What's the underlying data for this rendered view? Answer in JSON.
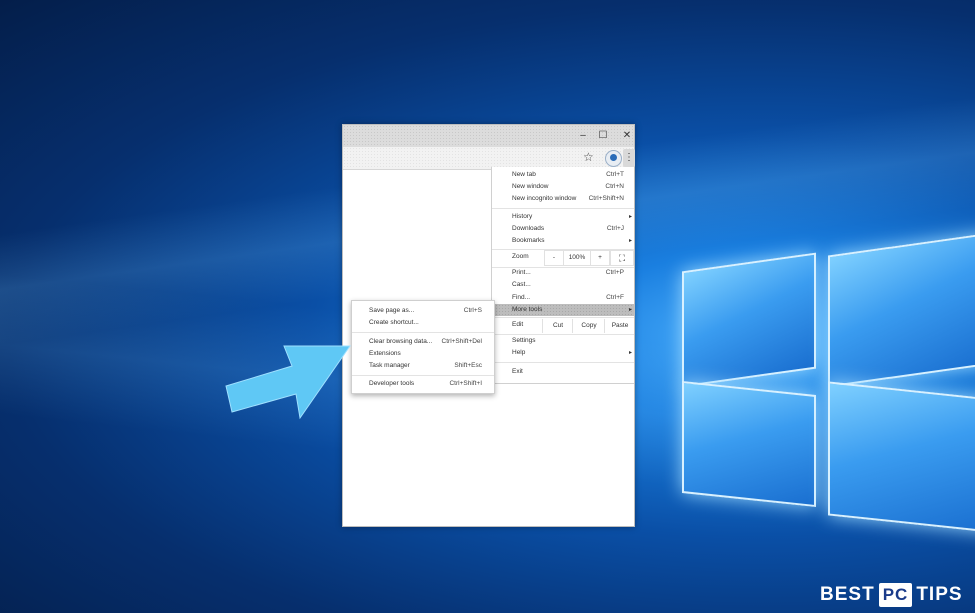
{
  "browser": {
    "window_controls": {
      "minimize": "–",
      "maximize": "☐",
      "close": "✕"
    },
    "toolbar": {
      "star": "☆",
      "menu": "⋮"
    }
  },
  "menu": {
    "items": [
      {
        "label": "New tab",
        "shortcut": "Ctrl+T"
      },
      {
        "label": "New window",
        "shortcut": "Ctrl+N"
      },
      {
        "label": "New incognito window",
        "shortcut": "Ctrl+Shift+N"
      },
      {
        "label": "History",
        "shortcut": ""
      },
      {
        "label": "Downloads",
        "shortcut": "Ctrl+J"
      },
      {
        "label": "Bookmarks",
        "shortcut": ""
      },
      {
        "label": "Print...",
        "shortcut": "Ctrl+P"
      },
      {
        "label": "Cast...",
        "shortcut": ""
      },
      {
        "label": "Find...",
        "shortcut": "Ctrl+F"
      },
      {
        "label": "More tools",
        "shortcut": ""
      },
      {
        "label": "Settings",
        "shortcut": ""
      },
      {
        "label": "Help",
        "shortcut": ""
      },
      {
        "label": "Exit",
        "shortcut": ""
      }
    ],
    "zoom": {
      "label": "Zoom",
      "minus": "-",
      "value": "100%",
      "plus": "+",
      "fullscreen": "⛶"
    },
    "edit": {
      "label": "Edit",
      "cut": "Cut",
      "copy": "Copy",
      "paste": "Paste"
    },
    "submenu_arrow": "▸"
  },
  "submenu": {
    "items": [
      {
        "label": "Save page as...",
        "shortcut": "Ctrl+S"
      },
      {
        "label": "Create shortcut...",
        "shortcut": ""
      },
      {
        "label": "Clear browsing data...",
        "shortcut": "Ctrl+Shift+Del"
      },
      {
        "label": "Extensions",
        "shortcut": ""
      },
      {
        "label": "Task manager",
        "shortcut": "Shift+Esc"
      },
      {
        "label": "Developer tools",
        "shortcut": "Ctrl+Shift+I"
      }
    ]
  },
  "watermark": {
    "part1": "BEST",
    "part2": "PC",
    "part3": "TIPS"
  },
  "colors": {
    "arrow": "#5fc8f5",
    "highlight": "#bdbdbd",
    "desktop_blue": "#0a4fa6"
  }
}
